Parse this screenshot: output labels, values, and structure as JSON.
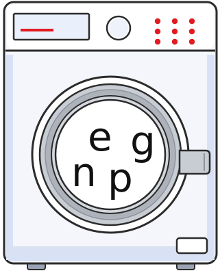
{
  "colors": {
    "outline": "#2b2b2b",
    "body_fill": "#f4f6fb",
    "body_shade": "#d9e2f4",
    "panel_fill": "#ffffff",
    "indicator_red": "#e01b22",
    "door_ring": "#c8ccd3",
    "door_ring_dark": "#8f949c",
    "glass_fill": "#ffffff",
    "letter_color": "#111111"
  },
  "icons": {
    "drawer": "detergent-drawer-icon",
    "dial": "program-dial-icon",
    "lights": "indicator-lights-icon",
    "door": "porthole-door-icon",
    "handle": "door-handle-icon",
    "filter": "filter-cover-icon",
    "feet": "machine-feet-icon"
  },
  "indicator_lights": {
    "rows": 3,
    "columns": 3
  },
  "drum_letters": {
    "letter_1": "e",
    "letter_2": "g",
    "letter_3": "n",
    "letter_4": "p"
  }
}
